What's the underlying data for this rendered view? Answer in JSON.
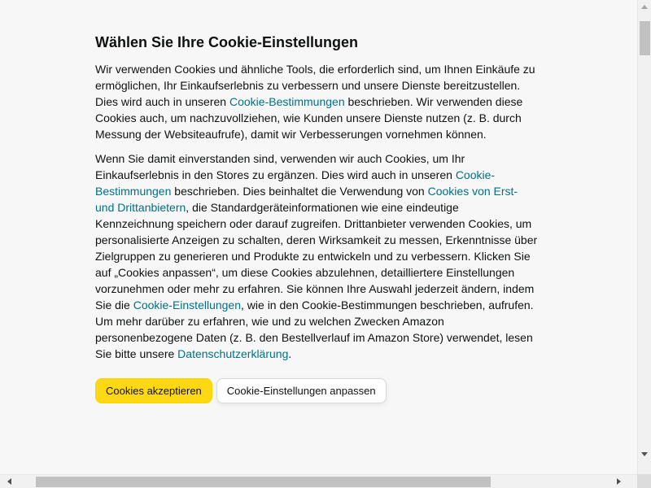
{
  "dialog": {
    "title": "Wählen Sie Ihre Cookie-Einstellungen",
    "para1": {
      "t1": "Wir verwenden Cookies und ähnliche Tools, die erforderlich sind, um Ihnen Einkäufe zu ermöglichen, Ihr Einkaufserlebnis zu verbessern und unsere Dienste bereitzustellen. Dies wird auch in unseren ",
      "link1": "Cookie-Bestimmungen",
      "t2": " beschrieben. Wir verwenden diese Cookies auch, um nachzuvollziehen, wie Kunden unsere Dienste nutzen (z. B. durch Messung der Websiteaufrufe), damit wir Verbesserungen vornehmen können."
    },
    "para2": {
      "t1": "Wenn Sie damit einverstanden sind, verwenden wir auch Cookies, um Ihr Einkaufserlebnis in den Stores zu ergänzen. Dies wird auch in unseren ",
      "link1": "Cookie-Bestimmungen",
      "t2": " beschrieben. Dies beinhaltet die Verwendung von ",
      "link2": "Cookies von Erst- und Drittanbietern",
      "t3": ", die Standardgeräteinformationen wie eine eindeutige Kennzeichnung speichern oder darauf zugreifen. Drittanbieter verwenden Cookies, um personalisierte Anzeigen zu schalten, deren Wirksamkeit zu messen, Erkenntnisse über Zielgruppen zu generieren und Produkte zu entwickeln und zu verbessern. Klicken Sie auf „Cookies anpassen“, um diese Cookies abzulehnen, detailliertere Einstellungen vorzunehmen oder mehr zu erfahren. Sie können Ihre Auswahl jederzeit ändern, indem Sie die ",
      "link3": "Cookie-Einstellungen",
      "t4": ", wie in den Cookie-Bestimmungen beschrieben, aufrufen. Um mehr darüber zu erfahren, wie und zu welchen Zwecken Amazon personenbezogene Daten (z. B. den Bestellverlauf im Amazon Store) verwendet, lesen Sie bitte unsere ",
      "link4": "Datenschutzerklärung",
      "t5": "."
    },
    "buttons": {
      "accept": "Cookies akzeptieren",
      "customize": "Cookie-Einstellungen anpassen"
    }
  },
  "colors": {
    "accent_yellow": "#ffd814",
    "link": "#007185",
    "text": "#0f1111",
    "background": "#f7f7f7"
  },
  "icons": {
    "scroll_up": "triangle-up-icon",
    "scroll_down": "triangle-down-icon",
    "scroll_left": "triangle-left-icon",
    "scroll_right": "triangle-right-icon"
  }
}
